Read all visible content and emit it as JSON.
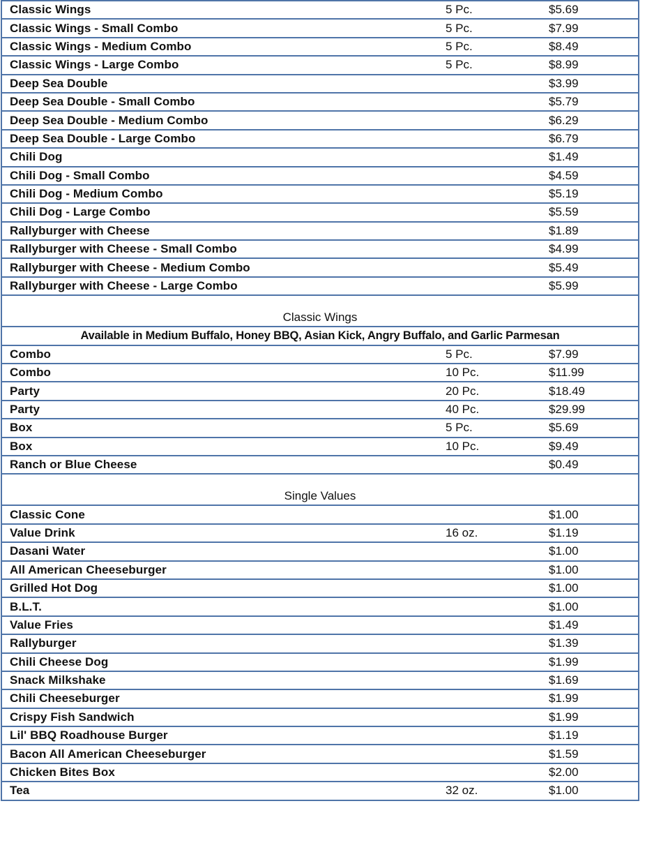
{
  "document": {
    "border_color": "#4f74a8",
    "sections": [
      {
        "header": null,
        "note": null,
        "items": [
          {
            "name": "Classic Wings",
            "size": "5 Pc.",
            "price": "$5.69"
          },
          {
            "name": "Classic Wings - Small Combo",
            "size": "5 Pc.",
            "price": "$7.99"
          },
          {
            "name": "Classic Wings - Medium Combo",
            "size": "5 Pc.",
            "price": "$8.49"
          },
          {
            "name": "Classic Wings - Large Combo",
            "size": "5 Pc.",
            "price": "$8.99"
          },
          {
            "name": "Deep Sea Double",
            "size": "",
            "price": "$3.99"
          },
          {
            "name": "Deep Sea Double - Small Combo",
            "size": "",
            "price": "$5.79"
          },
          {
            "name": "Deep Sea Double - Medium Combo",
            "size": "",
            "price": "$6.29"
          },
          {
            "name": "Deep Sea Double - Large Combo",
            "size": "",
            "price": "$6.79"
          },
          {
            "name": "Chili Dog",
            "size": "",
            "price": "$1.49"
          },
          {
            "name": "Chili Dog - Small Combo",
            "size": "",
            "price": "$4.59"
          },
          {
            "name": "Chili Dog - Medium Combo",
            "size": "",
            "price": "$5.19"
          },
          {
            "name": "Chili Dog - Large Combo",
            "size": "",
            "price": "$5.59"
          },
          {
            "name": "Rallyburger with Cheese",
            "size": "",
            "price": "$1.89"
          },
          {
            "name": "Rallyburger with Cheese - Small Combo",
            "size": "",
            "price": "$4.99"
          },
          {
            "name": "Rallyburger with Cheese - Medium Combo",
            "size": "",
            "price": "$5.49"
          },
          {
            "name": "Rallyburger with Cheese - Large Combo",
            "size": "",
            "price": "$5.99"
          }
        ]
      },
      {
        "header": "Classic Wings",
        "note": "Available in Medium Buffalo, Honey BBQ, Asian Kick, Angry Buffalo, and Garlic Parmesan",
        "items": [
          {
            "name": "Combo",
            "size": "5 Pc.",
            "price": "$7.99"
          },
          {
            "name": "Combo",
            "size": "10 Pc.",
            "price": "$11.99"
          },
          {
            "name": "Party",
            "size": "20 Pc.",
            "price": "$18.49"
          },
          {
            "name": "Party",
            "size": "40 Pc.",
            "price": "$29.99"
          },
          {
            "name": "Box",
            "size": "5 Pc.",
            "price": "$5.69"
          },
          {
            "name": "Box",
            "size": "10 Pc.",
            "price": "$9.49"
          },
          {
            "name": "Ranch or Blue Cheese",
            "size": "",
            "price": "$0.49"
          }
        ]
      },
      {
        "header": "Single Values",
        "note": null,
        "items": [
          {
            "name": "Classic Cone",
            "size": "",
            "price": "$1.00"
          },
          {
            "name": "Value Drink",
            "size": "16 oz.",
            "price": "$1.19"
          },
          {
            "name": "Dasani Water",
            "size": "",
            "price": "$1.00"
          },
          {
            "name": "All American Cheeseburger",
            "size": "",
            "price": "$1.00"
          },
          {
            "name": "Grilled Hot Dog",
            "size": "",
            "price": "$1.00"
          },
          {
            "name": "B.L.T.",
            "size": "",
            "price": "$1.00"
          },
          {
            "name": "Value Fries",
            "size": "",
            "price": "$1.49"
          },
          {
            "name": "Rallyburger",
            "size": "",
            "price": "$1.39"
          },
          {
            "name": "Chili Cheese Dog",
            "size": "",
            "price": "$1.99"
          },
          {
            "name": "Snack Milkshake",
            "size": "",
            "price": "$1.69"
          },
          {
            "name": "Chili Cheeseburger",
            "size": "",
            "price": "$1.99"
          },
          {
            "name": "Crispy Fish Sandwich",
            "size": "",
            "price": "$1.99"
          },
          {
            "name": "Lil' BBQ Roadhouse Burger",
            "size": "",
            "price": "$1.19"
          },
          {
            "name": "Bacon All American Cheeseburger",
            "size": "",
            "price": "$1.59"
          },
          {
            "name": "Chicken Bites Box",
            "size": "",
            "price": "$2.00"
          },
          {
            "name": "Tea",
            "size": "32 oz.",
            "price": "$1.00"
          }
        ]
      }
    ]
  }
}
